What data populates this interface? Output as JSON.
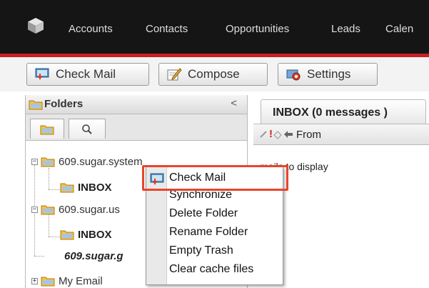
{
  "nav": {
    "items": [
      "Accounts",
      "Contacts",
      "Opportunities",
      "Leads",
      "Calen"
    ]
  },
  "toolbar": {
    "check_mail_label": "Check Mail",
    "compose_label": "Compose",
    "settings_label": "Settings"
  },
  "folders": {
    "title": "Folders",
    "collapse_glyph": "<",
    "tree": [
      {
        "label": "609.sugar.system",
        "bold": false,
        "italic": false
      },
      {
        "label": "INBOX",
        "bold": true,
        "italic": false
      },
      {
        "label": "609.sugar.us",
        "bold": false,
        "italic": false
      },
      {
        "label": "INBOX",
        "bold": true,
        "italic": false
      },
      {
        "label": "609.sugar.g",
        "bold": true,
        "italic": true
      },
      {
        "label": "My Email",
        "bold": false,
        "italic": false
      }
    ]
  },
  "inbox": {
    "tab_label": "INBOX (0 messages )",
    "col_from": "From",
    "empty_message": "mails to display"
  },
  "context_menu": {
    "items": [
      "Check Mail",
      "Synchronize",
      "Delete Folder",
      "Rename Folder",
      "Empty Trash",
      "Clear cache files"
    ]
  },
  "colors": {
    "nav_bg": "#151515",
    "nav_accent": "#c8211f",
    "highlight": "#e8452b"
  }
}
